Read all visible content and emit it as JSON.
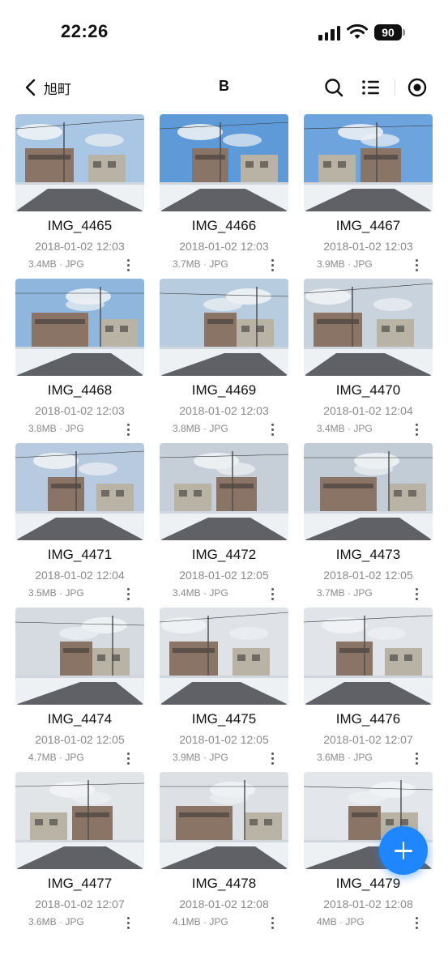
{
  "status_bar": {
    "time": "22:26",
    "battery": "90"
  },
  "header": {
    "back_label": "旭町",
    "title": "B"
  },
  "photos": [
    {
      "name": "IMG_4465",
      "date": "2018-01-02 12:03",
      "meta": "3.4MB · JPG",
      "sky": "#a9c6e4"
    },
    {
      "name": "IMG_4466",
      "date": "2018-01-02 12:03",
      "meta": "3.7MB · JPG",
      "sky": "#5f9ad8"
    },
    {
      "name": "IMG_4467",
      "date": "2018-01-02 12:03",
      "meta": "3.9MB · JPG",
      "sky": "#6ea4de"
    },
    {
      "name": "IMG_4468",
      "date": "2018-01-02 12:03",
      "meta": "3.8MB · JPG",
      "sky": "#8fb6dd"
    },
    {
      "name": "IMG_4469",
      "date": "2018-01-02 12:03",
      "meta": "3.8MB · JPG",
      "sky": "#b8cce0"
    },
    {
      "name": "IMG_4470",
      "date": "2018-01-02 12:04",
      "meta": "3.4MB · JPG",
      "sky": "#c9d3dd"
    },
    {
      "name": "IMG_4471",
      "date": "2018-01-02 12:04",
      "meta": "3.5MB · JPG",
      "sky": "#b7cadf"
    },
    {
      "name": "IMG_4472",
      "date": "2018-01-02 12:05",
      "meta": "3.4MB · JPG",
      "sky": "#c6cfd8"
    },
    {
      "name": "IMG_4473",
      "date": "2018-01-02 12:05",
      "meta": "3.7MB · JPG",
      "sky": "#c2ccd6"
    },
    {
      "name": "IMG_4474",
      "date": "2018-01-02 12:05",
      "meta": "4.7MB · JPG",
      "sky": "#d5dbe1"
    },
    {
      "name": "IMG_4475",
      "date": "2018-01-02 12:05",
      "meta": "3.9MB · JPG",
      "sky": "#dfe3e7"
    },
    {
      "name": "IMG_4476",
      "date": "2018-01-02 12:07",
      "meta": "3.6MB · JPG",
      "sky": "#e1e5e9"
    },
    {
      "name": "IMG_4477",
      "date": "2018-01-02 12:07",
      "meta": "3.6MB · JPG",
      "sky": "#e2e5e8"
    },
    {
      "name": "IMG_4478",
      "date": "2018-01-02 12:08",
      "meta": "4.1MB · JPG",
      "sky": "#dde1e5"
    },
    {
      "name": "IMG_4479",
      "date": "2018-01-02 12:08",
      "meta": "4MB · JPG",
      "sky": "#e3e6ea"
    }
  ],
  "colors": {
    "accent": "#1f86ff",
    "secondary_text": "#8a8a8a"
  }
}
